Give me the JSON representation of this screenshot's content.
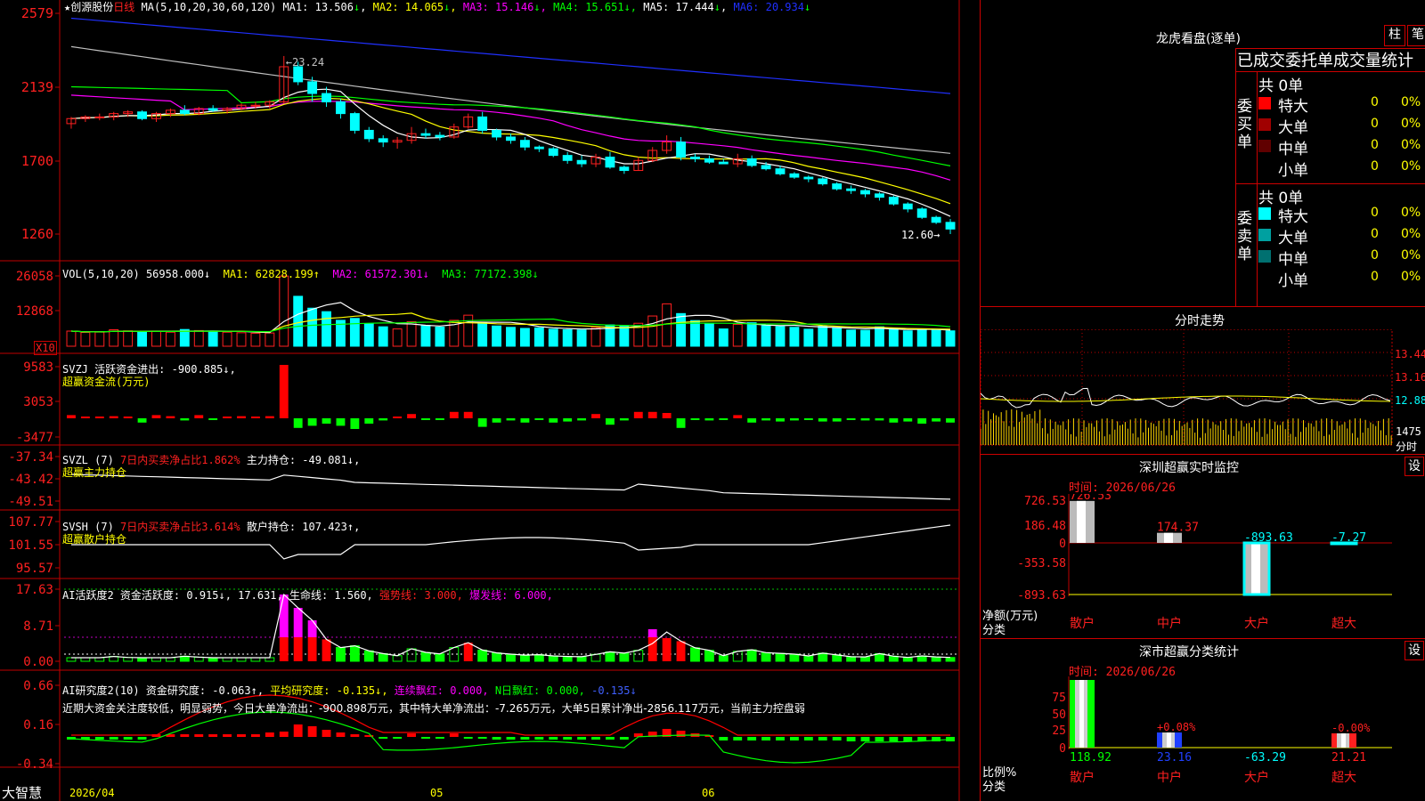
{
  "colors": {
    "up": "#ff2020",
    "down": "#00ffff",
    "ma1": "#ffffff",
    "ma2": "#ffff00",
    "ma3": "#ff00ff",
    "ma4": "#00ff00",
    "ma5": "#c0c0c0",
    "ma6": "#2030ff",
    "grid": "#c00000"
  },
  "header": {
    "star": "★",
    "stock_name": "创源股份",
    "period": "日线",
    "ma_label": "MA(5,10,20,30,60,120)",
    "ma_values": [
      {
        "label": "MA1:",
        "value": "13.506",
        "arrow": "↓"
      },
      {
        "label": "MA2:",
        "value": "14.065",
        "arrow": "↓"
      },
      {
        "label": "MA3:",
        "value": "15.146",
        "arrow": "↓"
      },
      {
        "label": "MA4:",
        "value": "15.651",
        "arrow": "↓"
      },
      {
        "label": "MA5:",
        "value": "17.444",
        "arrow": "↓"
      },
      {
        "label": "MA6:",
        "value": "20.934",
        "arrow": "↓"
      }
    ]
  },
  "price_axis": [
    "2579",
    "2139",
    "1700",
    "1260"
  ],
  "annotations": {
    "high": "23.24",
    "low": "12.60"
  },
  "vol": {
    "axis": [
      "26058",
      "12868"
    ],
    "unit": "X10",
    "title": "VOL(5,10,20)",
    "value": "56958.000↓",
    "ma1": "MA1: 62828.199↑",
    "ma2": "MA2: 61572.301↓",
    "ma3": "MA3: 77172.398↓"
  },
  "svzj": {
    "axis": [
      "9583",
      "3053",
      "-3477"
    ],
    "title": "SVZJ",
    "l1": "活跃资金进出: -900.885↓,",
    "l2": "超赢资金流(万元)"
  },
  "svzl": {
    "axis": [
      "-37.34",
      "-43.42",
      "-49.51"
    ],
    "title": "SVZL (7)",
    "l1a": "7日内买卖净占比1.862%",
    "l1b": "主力持仓: -49.081↓,",
    "l2": "超赢主力持仓"
  },
  "svsh": {
    "axis": [
      "107.77",
      "101.55",
      "95.57"
    ],
    "title": "SVSH (7)",
    "l1a": "7日内买卖净占比3.614%",
    "l1b": "散户持仓: 107.423↑,",
    "l2": "超赢散户持仓"
  },
  "ai1": {
    "axis": [
      "17.63",
      "8.71",
      "0.00"
    ],
    "title": "AI活跃度2",
    "a": "资金活跃度: 0.915↓, 17.631,",
    "b": "生命线: 1.560,",
    "c": "强势线: 3.000,",
    "d": "爆发线: 6.000,"
  },
  "ai2": {
    "axis": [
      "0.66",
      "0.16",
      "-0.34"
    ],
    "title": "AI研究度2(10)",
    "a": "资金研究度: -0.063↑,",
    "b": "平均研究度: -0.135↓,",
    "c": "连续飘红: 0.000,",
    "d": "N日飘红: 0.000,",
    "e": "-0.135↓",
    "comment": "近期大资金关注度较低，明显弱势，今日大单净流出：-900.898万元，其中特大单净流出：-7.265万元，大单5日累计净出-2856.117万元，当前主力控盘弱"
  },
  "footer": {
    "brand": "大智慧",
    "d1": "2026/04",
    "d2": "05",
    "d3": "06"
  },
  "right": {
    "lhkp": {
      "title": "龙虎看盘(逐单)",
      "btn1": "柱",
      "btn2": "笔",
      "heading": "已成交委托单成交量统计"
    },
    "buy": {
      "side": "委买单",
      "total": "共 0单",
      "rows": [
        {
          "label": "特大",
          "count": "0",
          "pct": "0%",
          "color": "#ff0000"
        },
        {
          "label": "大单",
          "count": "0",
          "pct": "0%",
          "color": "#a00000"
        },
        {
          "label": "中单",
          "count": "0",
          "pct": "0%",
          "color": "#600000"
        },
        {
          "label": "小单",
          "count": "0",
          "pct": "0%",
          "color": ""
        }
      ]
    },
    "sell": {
      "side": "委卖单",
      "total": "共 0单",
      "rows": [
        {
          "label": "特大",
          "count": "0",
          "pct": "0%",
          "color": "#00ffff"
        },
        {
          "label": "大单",
          "count": "0",
          "pct": "0%",
          "color": "#00a0a0"
        },
        {
          "label": "中单",
          "count": "0",
          "pct": "0%",
          "color": "#007070"
        },
        {
          "label": "小单",
          "count": "0",
          "pct": "0%",
          "color": ""
        }
      ]
    },
    "fenshi": {
      "title": "分时走势",
      "p": [
        "13.44",
        "13.16",
        "12.88"
      ],
      "v": "1475",
      "unit": "分时"
    },
    "monitor": {
      "title": "深圳超赢实时监控",
      "btn": "设",
      "time": "时间: 2026/06/26",
      "axis": [
        "726.53",
        "186.48",
        "0",
        "-353.58",
        "-893.63"
      ],
      "ylabel": "净额(万元)",
      "xlabel": "分类",
      "values": [
        726.53,
        174.37,
        -893.63,
        -7.27
      ],
      "labels": [
        "726.53",
        "174.37",
        "-893.63",
        "-7.27"
      ],
      "cats": [
        "散户",
        "中户",
        "大户",
        "超大"
      ]
    },
    "stats": {
      "title": "深市超赢分类统计",
      "btn": "设",
      "time": "时间: 2026/06/26",
      "axis": [
        "75",
        "50",
        "25",
        "0"
      ],
      "ylabel": "比例%",
      "xlabel": "分类",
      "top": [
        "",
        "+0.08%",
        "",
        "-0.00%"
      ],
      "bottom": [
        "118.92",
        "23.16",
        "-63.29",
        "21.21"
      ],
      "values": [
        118.92,
        23.16,
        -63.29,
        21.21
      ],
      "cats": [
        "散户",
        "中户",
        "大户",
        "超大"
      ]
    }
  },
  "chart_data": {
    "type": "candlestick",
    "title": "创源股份 日线",
    "ylim": [
      12.0,
      26.5
    ],
    "x_ticks": [
      "2026/04",
      "05",
      "06"
    ],
    "candles": [
      [
        19.2,
        19.6,
        18.9,
        19.5
      ],
      [
        19.5,
        19.7,
        19.3,
        19.6
      ],
      [
        19.6,
        19.8,
        19.4,
        19.6
      ],
      [
        19.6,
        19.9,
        19.4,
        19.8
      ],
      [
        19.8,
        20.0,
        19.6,
        19.9
      ],
      [
        19.9,
        20.0,
        19.4,
        19.5
      ],
      [
        19.5,
        19.9,
        19.3,
        19.8
      ],
      [
        19.8,
        20.1,
        19.6,
        20.0
      ],
      [
        20.0,
        20.3,
        19.7,
        19.8
      ],
      [
        19.8,
        20.2,
        19.7,
        20.1
      ],
      [
        20.1,
        20.3,
        19.9,
        20.0
      ],
      [
        20.0,
        20.2,
        19.8,
        20.1
      ],
      [
        20.1,
        20.4,
        20.0,
        20.3
      ],
      [
        20.3,
        20.5,
        20.1,
        20.3
      ],
      [
        20.3,
        20.6,
        20.1,
        20.5
      ],
      [
        20.5,
        23.24,
        20.4,
        22.6
      ],
      [
        22.6,
        22.9,
        21.5,
        21.7
      ],
      [
        21.7,
        22.0,
        20.5,
        21.0
      ],
      [
        21.0,
        21.4,
        20.2,
        20.5
      ],
      [
        20.5,
        20.7,
        19.5,
        19.8
      ],
      [
        19.8,
        19.9,
        18.6,
        18.8
      ],
      [
        18.8,
        19.0,
        18.1,
        18.3
      ],
      [
        18.3,
        18.5,
        17.8,
        18.1
      ],
      [
        18.1,
        18.4,
        17.7,
        18.2
      ],
      [
        18.2,
        19.0,
        18.0,
        18.6
      ],
      [
        18.6,
        18.9,
        18.3,
        18.5
      ],
      [
        18.5,
        18.7,
        18.2,
        18.4
      ],
      [
        18.4,
        19.2,
        18.3,
        19.0
      ],
      [
        19.0,
        19.8,
        18.9,
        19.6
      ],
      [
        19.6,
        19.9,
        18.6,
        18.8
      ],
      [
        18.8,
        18.9,
        18.2,
        18.4
      ],
      [
        18.4,
        18.6,
        18.0,
        18.2
      ],
      [
        18.2,
        18.4,
        17.6,
        17.8
      ],
      [
        17.8,
        17.9,
        17.5,
        17.7
      ],
      [
        17.7,
        17.8,
        17.2,
        17.3
      ],
      [
        17.3,
        17.5,
        16.8,
        17.0
      ],
      [
        17.0,
        17.3,
        16.6,
        16.8
      ],
      [
        16.8,
        17.4,
        16.6,
        17.2
      ],
      [
        17.2,
        17.5,
        16.5,
        16.6
      ],
      [
        16.6,
        16.7,
        16.2,
        16.4
      ],
      [
        16.4,
        17.2,
        16.4,
        17.0
      ],
      [
        17.0,
        17.8,
        16.9,
        17.6
      ],
      [
        17.6,
        18.5,
        17.4,
        18.1
      ],
      [
        18.1,
        18.4,
        17.0,
        17.2
      ],
      [
        17.2,
        17.4,
        16.9,
        17.1
      ],
      [
        17.1,
        17.3,
        16.8,
        16.9
      ],
      [
        16.9,
        17.1,
        16.8,
        16.8
      ],
      [
        16.8,
        17.4,
        16.6,
        17.1
      ],
      [
        17.1,
        17.3,
        16.6,
        16.7
      ],
      [
        16.7,
        16.9,
        16.4,
        16.5
      ],
      [
        16.5,
        16.7,
        16.1,
        16.2
      ],
      [
        16.2,
        16.3,
        15.9,
        16.0
      ],
      [
        16.0,
        16.1,
        15.7,
        15.9
      ],
      [
        15.9,
        16.0,
        15.5,
        15.6
      ],
      [
        15.6,
        15.7,
        15.2,
        15.3
      ],
      [
        15.3,
        15.5,
        15.0,
        15.2
      ],
      [
        15.2,
        15.3,
        14.8,
        15.0
      ],
      [
        15.0,
        15.1,
        14.6,
        14.8
      ],
      [
        14.8,
        14.9,
        14.3,
        14.4
      ],
      [
        14.4,
        14.5,
        13.9,
        14.1
      ],
      [
        14.1,
        14.2,
        13.5,
        13.6
      ],
      [
        13.6,
        13.7,
        13.2,
        13.3
      ],
      [
        13.3,
        13.5,
        12.6,
        12.9
      ]
    ],
    "volume": [
      56000,
      51000,
      52000,
      61000,
      57000,
      53000,
      56000,
      52000,
      62000,
      58000,
      54000,
      52000,
      50000,
      48000,
      49000,
      260000,
      185000,
      141000,
      128000,
      96000,
      103000,
      83000,
      72000,
      64000,
      91000,
      77000,
      71000,
      96000,
      115000,
      86000,
      75000,
      70000,
      66000,
      68000,
      63000,
      61000,
      60000,
      69000,
      79000,
      74000,
      85000,
      112000,
      157000,
      121000,
      95000,
      85000,
      64000,
      81000,
      87000,
      76000,
      73000,
      70000,
      63000,
      74000,
      67000,
      60000,
      59000,
      72000,
      62000,
      57000,
      63000,
      59000,
      56958
    ]
  }
}
